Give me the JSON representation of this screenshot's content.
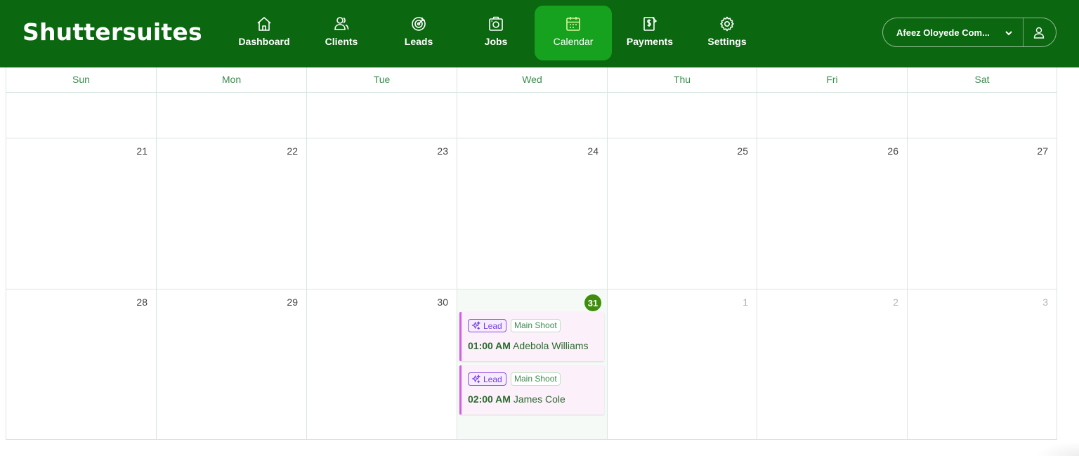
{
  "app": {
    "logo": "Shuttersuites"
  },
  "nav": [
    {
      "label": "Dashboard",
      "icon": "home-icon",
      "active": false
    },
    {
      "label": "Clients",
      "icon": "users-icon",
      "active": false
    },
    {
      "label": "Leads",
      "icon": "target-icon",
      "active": false
    },
    {
      "label": "Jobs",
      "icon": "camera-icon",
      "active": false
    },
    {
      "label": "Calendar",
      "icon": "calendar-icon",
      "active": true
    },
    {
      "label": "Payments",
      "icon": "invoice-dollar-icon",
      "active": false
    },
    {
      "label": "Settings",
      "icon": "gear-icon",
      "active": false
    }
  ],
  "account": {
    "name": "Afeez Oloyede Com...",
    "dropdown_icon": "chevron-down-icon",
    "user_icon": "user-icon"
  },
  "calendar": {
    "weekdays": [
      "Sun",
      "Mon",
      "Tue",
      "Wed",
      "Thu",
      "Fri",
      "Sat"
    ],
    "weeks": [
      {
        "days": [
          "",
          "",
          "",
          "",
          "",
          "",
          ""
        ]
      },
      {
        "days": [
          "21",
          "22",
          "23",
          "24",
          "25",
          "26",
          "27"
        ]
      },
      {
        "days": [
          "28",
          "29",
          "30",
          "31",
          "1",
          "2",
          "3"
        ]
      }
    ],
    "today": "31",
    "events": [
      {
        "lead_label": "Lead",
        "type": "Main Shoot",
        "time": "01:00 AM",
        "name": "Adebola Williams"
      },
      {
        "lead_label": "Lead",
        "type": "Main Shoot",
        "time": "02:00 AM",
        "name": "James Cole"
      }
    ]
  },
  "colors": {
    "header_bg": "#0b6710",
    "nav_active_bg": "#16a11e",
    "today_badge": "#3f8d0d",
    "event_bg": "#fcf0fb",
    "event_border": "#d25fe3",
    "lead_tag": "#7a3ee0"
  }
}
